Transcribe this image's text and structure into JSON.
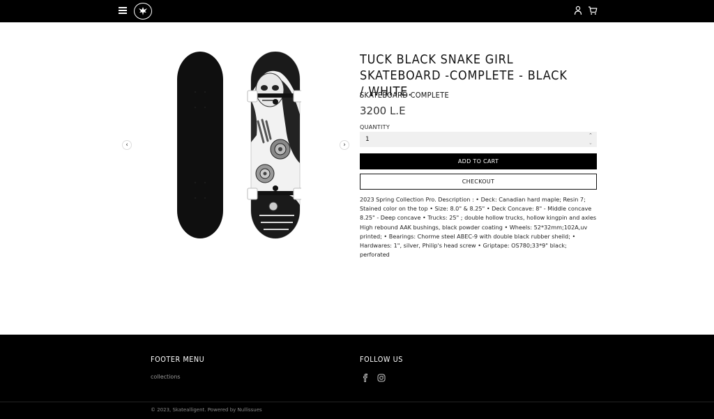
{
  "header": {
    "menu_icon": "hamburger-menu-icon",
    "logo_icon": "eagle-logo-icon",
    "account_icon": "user-icon",
    "cart_icon": "cart-icon",
    "background_color": "#000000"
  },
  "gallery": {
    "prev_icon": "chevron-left-icon",
    "next_icon": "chevron-right-icon",
    "prev_glyph": "‹",
    "next_glyph": "›",
    "image_name": "skateboard-product-image"
  },
  "product": {
    "title": "TUCK BLACK SNAKE GIRL SKATEBOARD -COMPLETE - BLACK / WHITE.",
    "subtitle": "SKATEBOARD COMPLETE",
    "price": "3200 L.E",
    "quantity_label": "QUANTITY",
    "quantity_value": "1",
    "qty_up_glyph": "⌃",
    "qty_down_glyph": "⌄",
    "add_to_cart_label": "ADD TO CART",
    "checkout_label": "CHECKOUT",
    "description": "2023 Spring Collection Pro. Description :  • Deck: Canadian hard maple; Resin 7; Stained color on the top  • Size: 8.0\" & 8.25\"  • Deck Concave: 8\" - Middle concave 8.25\" - Deep concave  • Trucks: 25\" ; double hollow trucks, hollow kingpin and axles High rebound AAK bushings, black powder coating  • Wheels: 52*32mm;102A,uv printed;  • Bearings: Chorme steel ABEC-9 with double black rubber sheild;   • Hardwares: 1\", silver, Philip's head screw  • Griptape: OS780;33*9\" black; perforated"
  },
  "footer": {
    "menu_title": "FOOTER MENU",
    "menu_links": [
      "collections"
    ],
    "follow_title": "FOLLOW US",
    "social_icons": [
      "facebook-icon",
      "instagram-icon"
    ],
    "copyright": "© 2023, Skatealligent. Powered by Nullissues",
    "background_color": "#000000"
  }
}
